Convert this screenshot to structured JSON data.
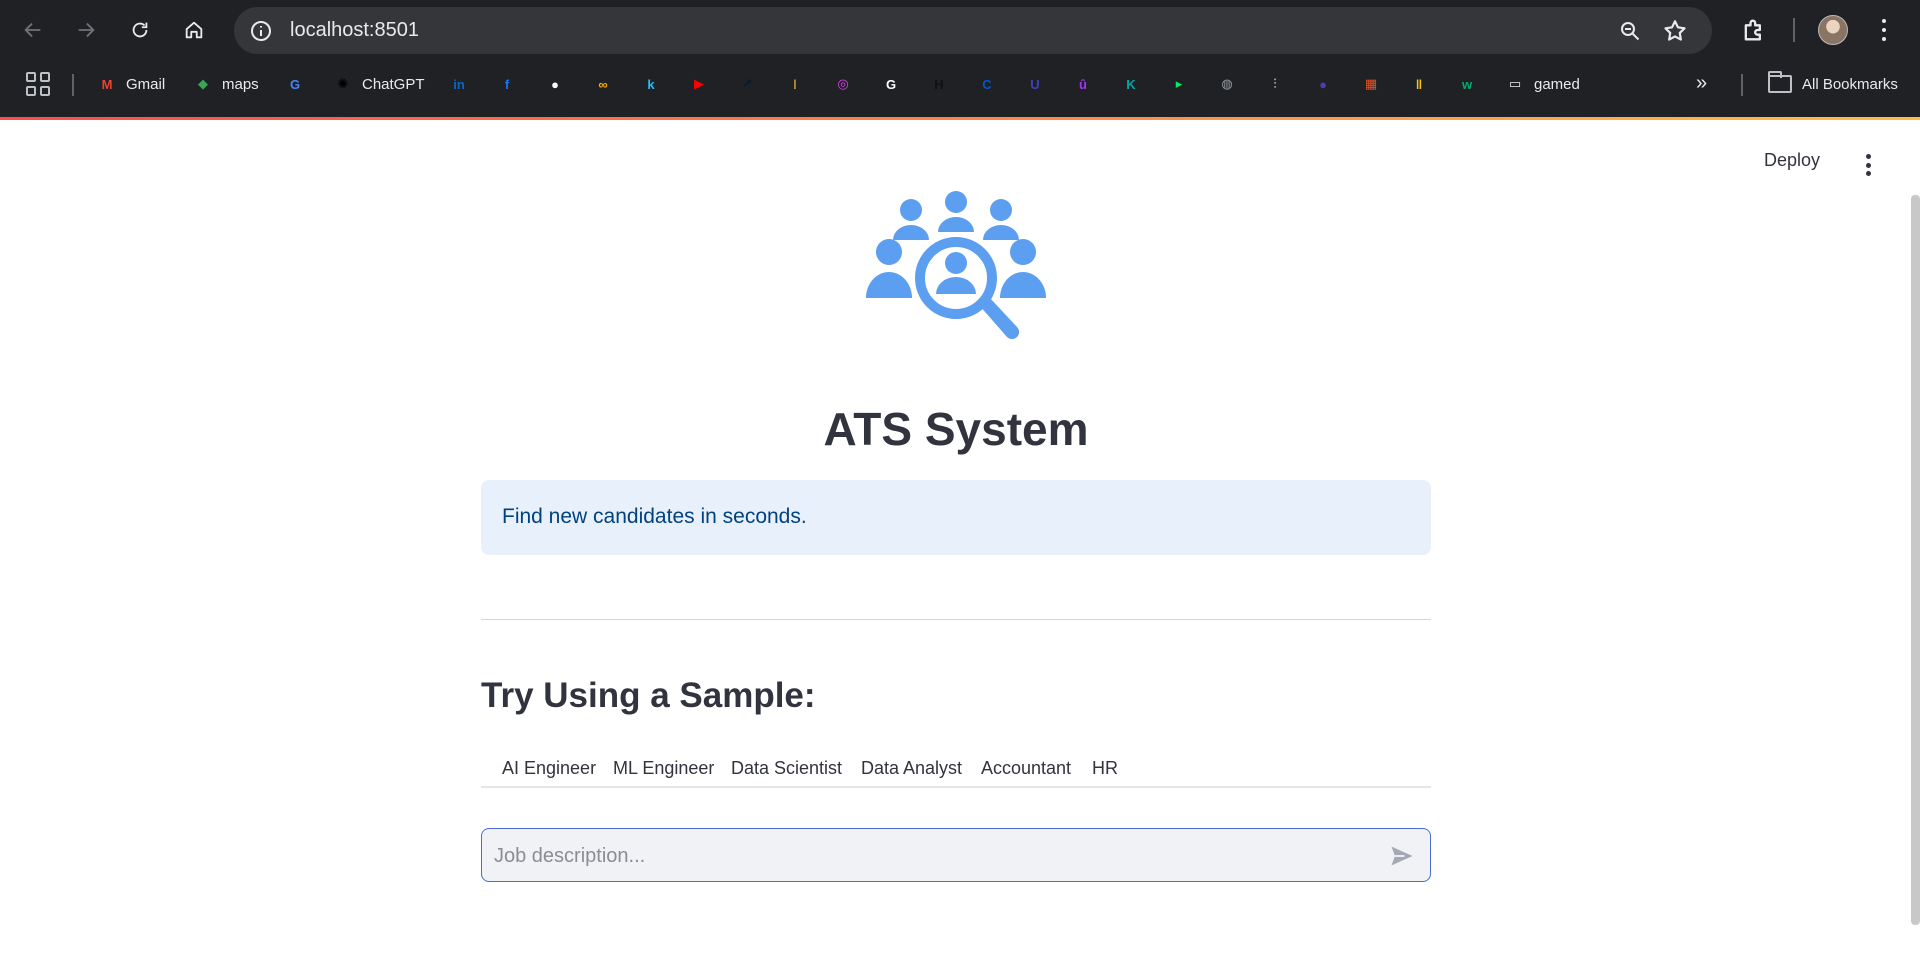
{
  "browser": {
    "url": "localhost:8501",
    "bookmarks": [
      {
        "label": "Gmail",
        "icon": "gmail-icon",
        "color": "#ea4335"
      },
      {
        "label": "maps",
        "icon": "maps-icon",
        "color": "#34a853"
      },
      {
        "label": "",
        "icon": "translate-icon",
        "color": "#4285f4"
      },
      {
        "label": "ChatGPT",
        "icon": "chatgpt-icon",
        "color": "#000000"
      },
      {
        "label": "",
        "icon": "linkedin-icon",
        "color": "#0a66c2"
      },
      {
        "label": "",
        "icon": "facebook-icon",
        "color": "#1877f2"
      },
      {
        "label": "",
        "icon": "github-icon",
        "color": "#ffffff"
      },
      {
        "label": "",
        "icon": "colab-icon",
        "color": "#f9ab00"
      },
      {
        "label": "",
        "icon": "kaggle-icon",
        "color": "#20beff"
      },
      {
        "label": "",
        "icon": "youtube-icon",
        "color": "#ff0000"
      },
      {
        "label": "",
        "icon": "chart-icon",
        "color": "#0b1a2e"
      },
      {
        "label": "",
        "icon": "torch-icon",
        "color": "#c89b3c"
      },
      {
        "label": "",
        "icon": "swirl-icon",
        "color": "#e040fb"
      },
      {
        "label": "",
        "icon": "google-icon",
        "color": "#ffffff"
      },
      {
        "label": "",
        "icon": "hackerrank-icon",
        "color": "#111111"
      },
      {
        "label": "",
        "icon": "coursera-icon",
        "color": "#0056d2"
      },
      {
        "label": "",
        "icon": "udacity-icon",
        "color": "#3f3fc4"
      },
      {
        "label": "",
        "icon": "udemy-icon",
        "color": "#a435f0"
      },
      {
        "label": "",
        "icon": "k-icon",
        "color": "#00a6a6"
      },
      {
        "label": "",
        "icon": "datacamp-icon",
        "color": "#03ef62"
      },
      {
        "label": "",
        "icon": "globe-icon",
        "color": "#9aa0a6"
      },
      {
        "label": "",
        "icon": "cisco-icon",
        "color": "#9aa0a6"
      },
      {
        "label": "",
        "icon": "dot-icon",
        "color": "#4b3fb0"
      },
      {
        "label": "",
        "icon": "microsoft-icon",
        "color": "#f25022"
      },
      {
        "label": "",
        "icon": "bars-icon",
        "color": "#f5c518"
      },
      {
        "label": "",
        "icon": "w3-icon",
        "color": "#04aa6d"
      },
      {
        "label": "gamed",
        "icon": "page-icon",
        "color": "#e8eaed"
      }
    ],
    "all_bookmarks_label": "All Bookmarks"
  },
  "app": {
    "deploy_label": "Deploy",
    "title": "ATS System",
    "info": "Find new candidates in seconds.",
    "section_title": "Try Using a Sample:",
    "tabs": [
      "AI Engineer",
      "ML Engineer",
      "Data Scientist",
      "Data Analyst",
      "Accountant",
      "HR"
    ],
    "chat_placeholder": "Job description...",
    "logo_color": "#5c9ef0"
  }
}
